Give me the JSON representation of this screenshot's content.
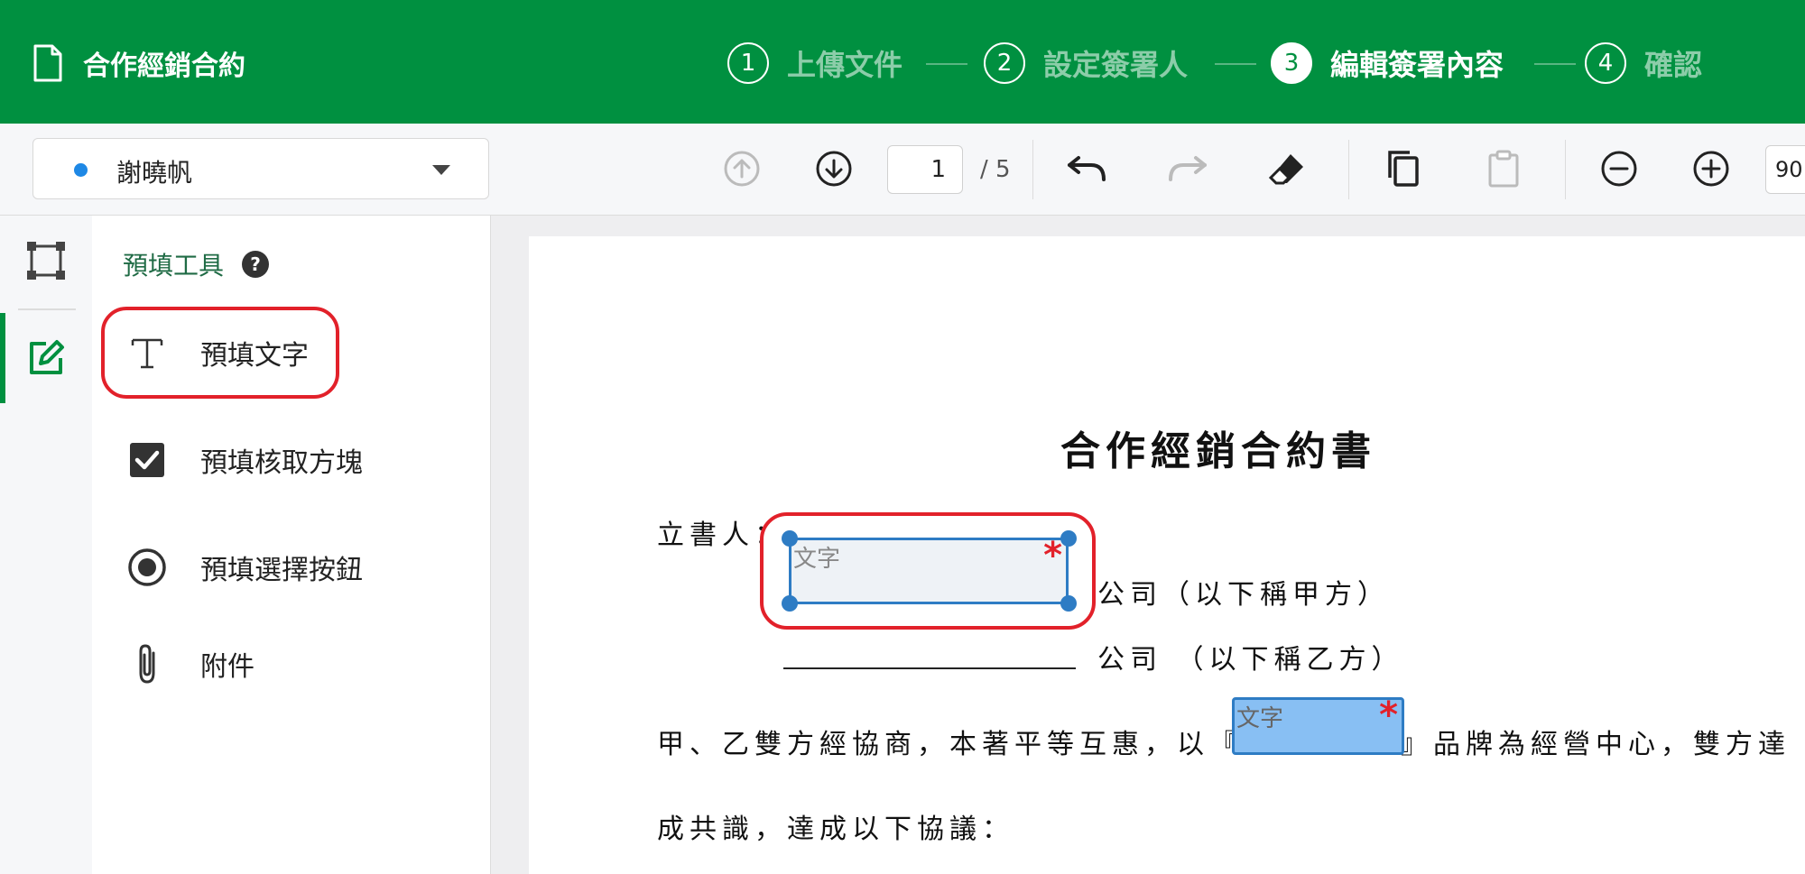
{
  "header": {
    "doc_title": "合作經銷合約",
    "steps": [
      {
        "num": "1",
        "label": "上傳文件"
      },
      {
        "num": "2",
        "label": "設定簽署人"
      },
      {
        "num": "3",
        "label": "編輯簽署內容"
      },
      {
        "num": "4",
        "label": "確認"
      }
    ],
    "active_step": 3
  },
  "toolbar": {
    "signer_name": "謝曉帆",
    "signer_color": "#1e88e5",
    "page_current": "1",
    "page_total": "/ 5",
    "zoom": "90."
  },
  "tools_panel": {
    "title": "預填工具",
    "help": "?",
    "items": [
      {
        "label": "預填文字",
        "icon": "text-icon"
      },
      {
        "label": "預填核取方塊",
        "icon": "checkbox-icon"
      },
      {
        "label": "預填選擇按鈕",
        "icon": "radio-icon"
      },
      {
        "label": "附件",
        "icon": "paperclip-icon"
      }
    ]
  },
  "document": {
    "title": "合作經銷合約書",
    "line1": "立書人：",
    "line2": "公司（以下稱甲方）",
    "line3": "公司 （以下稱乙方）",
    "line4_prefix": "甲、乙雙方經協商，本著平等互惠，以『",
    "line4_suffix": "』品牌為經營中心，雙方達",
    "line5": "成共識，達成以下協議：",
    "field1": {
      "placeholder": "文字",
      "required": "*"
    },
    "field2": {
      "placeholder": "文字",
      "required": "*"
    }
  },
  "colors": {
    "brand_green": "#009040",
    "highlight_red": "#e2212a",
    "field_blue": "#2e7cc4"
  }
}
